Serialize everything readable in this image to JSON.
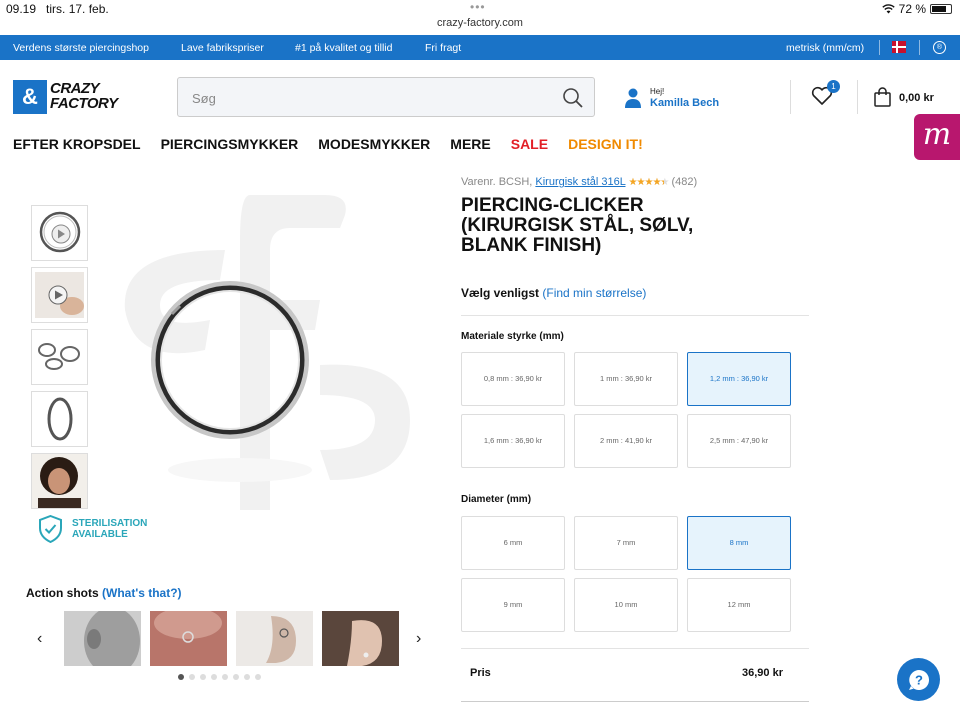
{
  "status_bar": {
    "time": "09.19",
    "date": "tirs. 17. feb.",
    "url": "crazy-factory.com",
    "battery": "72 %"
  },
  "promo_bar": {
    "items": [
      "Verdens største piercingshop",
      "Lave fabrikspriser",
      "#1 på kvalitet og tillid",
      "Fri fragt"
    ],
    "units": "metrisk (mm/cm)",
    "info_glyph": "®"
  },
  "header": {
    "logo_line1": "CRAZY",
    "logo_line2": "FACTORY",
    "logo_mark": "&",
    "search_placeholder": "Søg",
    "greeting": "Hej!",
    "user_name": "Kamilla Bech",
    "wishlist_count": "1",
    "cart_total": "0,00 kr",
    "side_badge": "m"
  },
  "nav": [
    "EFTER KROPSDEL",
    "PIERCINGSMYKKER",
    "MODESMYKKER",
    "MERE",
    "SALE",
    "DESIGN IT!"
  ],
  "gallery": {
    "sterilisation_line1": "STERILISATION",
    "sterilisation_line2": "AVAILABLE"
  },
  "action_shots": {
    "title": "Action shots",
    "link": "(What's that?)",
    "dot_count": 8,
    "active_dot": 0
  },
  "product": {
    "sku_prefix": "Varenr. BCSH,",
    "material_link": "Kirurgisk stål 316L",
    "stars": "★★★★★",
    "rating": 4.5,
    "review_count": "(482)",
    "title": "PIERCING-CLICKER (KIRURGISK STÅL, SØLV, BLANK FINISH)",
    "choose_label": "Vælg venligst",
    "size_link": "(Find min størrelse)",
    "thickness_label": "Materiale styrke (mm)",
    "thickness_options": [
      "0,8 mm : 36,90 kr",
      "1 mm : 36,90 kr",
      "1,2 mm : 36,90 kr",
      "1,6 mm : 36,90 kr",
      "2 mm : 41,90 kr",
      "2,5 mm : 47,90 kr"
    ],
    "thickness_selected": 2,
    "diameter_label": "Diameter (mm)",
    "diameter_options": [
      "6 mm",
      "7 mm",
      "8 mm",
      "9 mm",
      "10 mm",
      "12 mm"
    ],
    "diameter_selected": 2,
    "price_label": "Pris",
    "price_value": "36,90 kr"
  },
  "colors": {
    "brand_blue": "#1a73c7",
    "sale_red": "#e21f26",
    "design_orange": "#f08a00",
    "side_badge": "#b8176e"
  }
}
